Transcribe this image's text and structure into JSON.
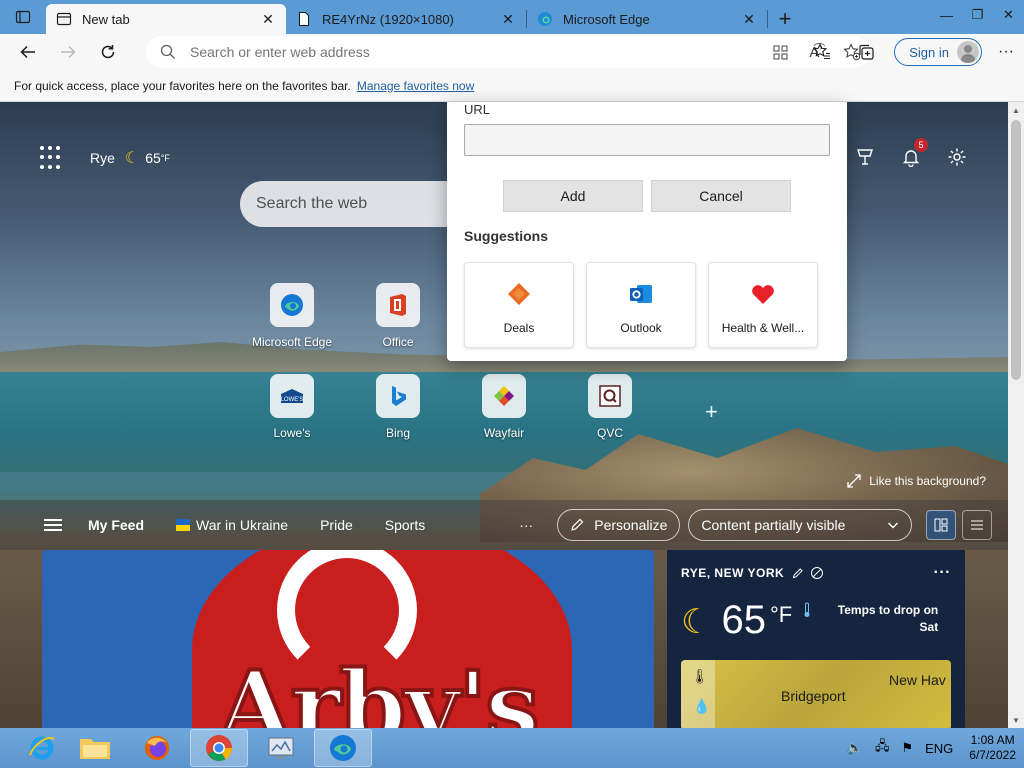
{
  "tabs": [
    {
      "title": "New tab",
      "active": true
    },
    {
      "title": "RE4YrNz (1920×1080)",
      "active": false
    },
    {
      "title": "Microsoft Edge",
      "active": false
    }
  ],
  "address": {
    "placeholder": "Search or enter web address"
  },
  "toolbar": {
    "signin_label": "Sign in"
  },
  "favorites_bar": {
    "text": "For quick access, place your favorites here on the favorites bar.",
    "link": "Manage favorites now"
  },
  "newtab": {
    "location": "Rye",
    "temp": "65",
    "temp_unit": "°F",
    "search_placeholder": "Search the web",
    "notification_count": "5",
    "tiles": [
      {
        "label": "Microsoft Edge",
        "icon": "edge-icon"
      },
      {
        "label": "Office",
        "icon": "office-icon"
      },
      {
        "label": "Lowe's",
        "icon": "lowes-icon"
      },
      {
        "label": "Bing",
        "icon": "bing-icon"
      },
      {
        "label": "Wayfair",
        "icon": "wayfair-icon"
      },
      {
        "label": "QVC",
        "icon": "qvc-icon"
      }
    ],
    "like_background": "Like this background?"
  },
  "feed": {
    "items": [
      "My Feed",
      "War in Ukraine",
      "Pride",
      "Sports"
    ],
    "more": "···",
    "personalize": "Personalize",
    "visibility": "Content partially visible"
  },
  "weather_card": {
    "location": "RYE, NEW YORK",
    "temp": "65",
    "unit": "°F",
    "forecast": "Temps to drop on Sat",
    "map_city_1": "Bridgeport",
    "map_city_2": "New Hav"
  },
  "dialog": {
    "url_label": "URL",
    "url_value": "",
    "add_label": "Add",
    "cancel_label": "Cancel",
    "suggestions_title": "Suggestions",
    "suggestions": [
      {
        "label": "Deals",
        "icon": "deals-icon"
      },
      {
        "label": "Outlook",
        "icon": "outlook-icon"
      },
      {
        "label": "Health & Well...",
        "icon": "heart-icon"
      }
    ]
  },
  "taskbar": {
    "language": "ENG",
    "time": "1:08 AM",
    "date": "6/7/2022"
  },
  "colors": {
    "tabstrip": "#5b9bd5",
    "accent_link": "#1f5f9f",
    "taskbar": "#5b95cc"
  }
}
